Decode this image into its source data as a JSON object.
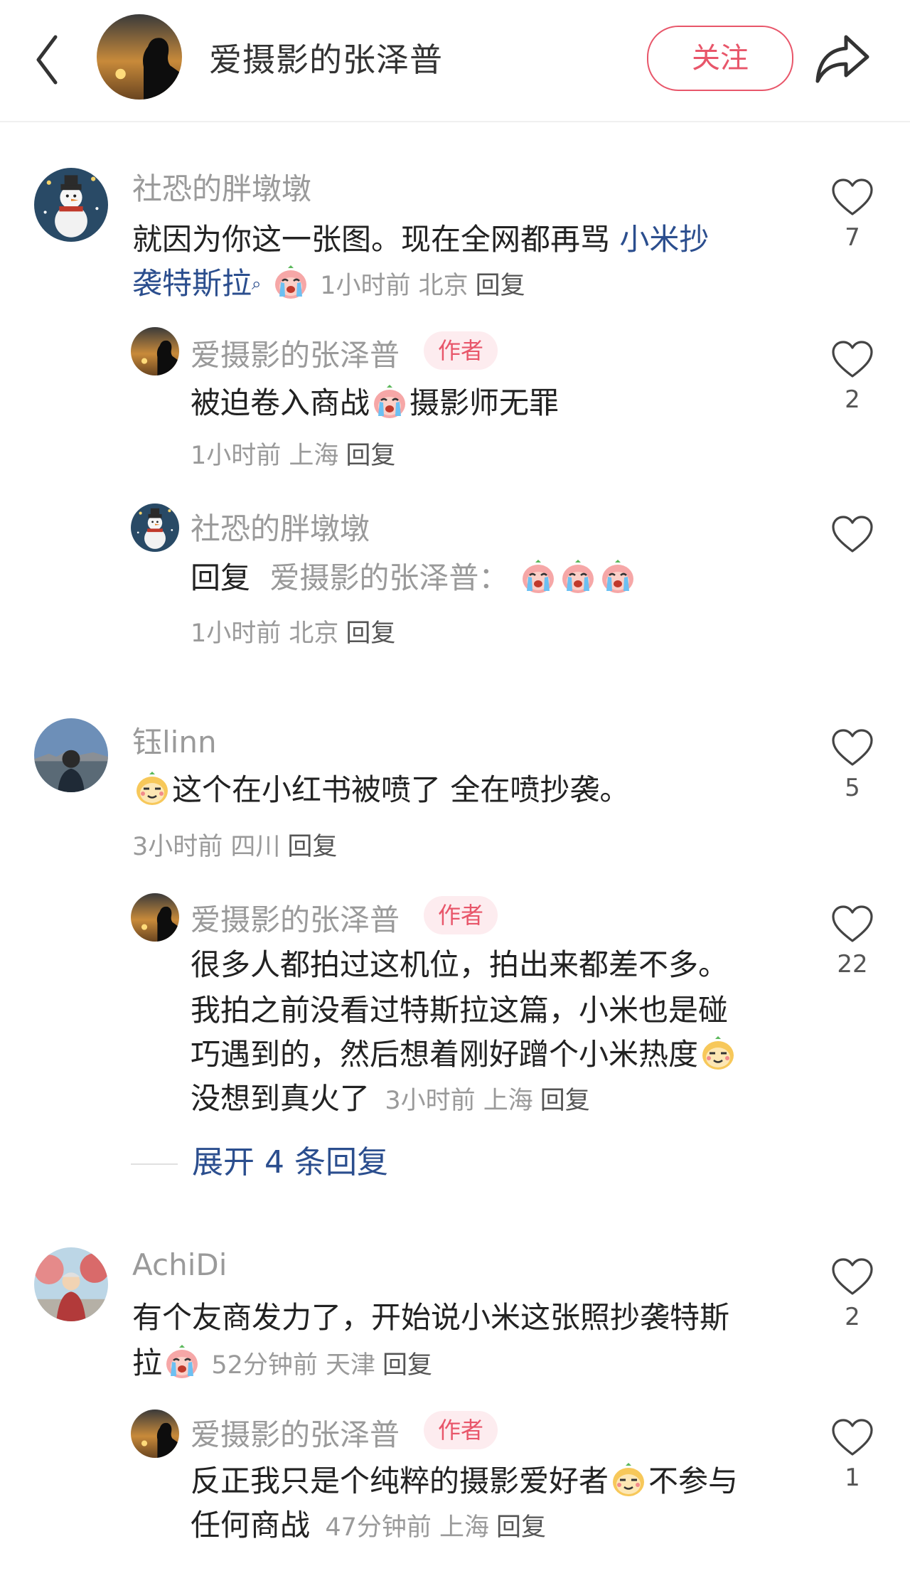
{
  "header": {
    "username": "爱摄影的张泽普",
    "follow_label": "关注"
  },
  "comments": [
    {
      "user": "社恐的胖墩墩",
      "text_before": "就因为你这一张图。现在全网都再骂 ",
      "link": "小米抄",
      "line2_link": "袭特斯拉",
      "meta": "1小时前 北京",
      "reply": "回复",
      "likes": "7"
    },
    {
      "user": "爱摄影的张泽普",
      "badge": "作者",
      "text_a": "被迫卷入商战",
      "text_b": "摄影师无罪",
      "meta": "1小时前 上海",
      "reply": "回复",
      "likes": "2"
    },
    {
      "user": "社恐的胖墩墩",
      "reply_prefix": "回复",
      "reply_target": "爱摄影的张泽普：",
      "meta": "1小时前 北京",
      "reply": "回复"
    },
    {
      "user": "钰linn",
      "text": "这个在小红书被喷了 全在喷抄袭。",
      "meta": "3小时前 四川",
      "reply": "回复",
      "likes": "5"
    },
    {
      "user": "爱摄影的张泽普",
      "badge": "作者",
      "line1": "很多人都拍过这机位，拍出来都差不多。",
      "line2": "我拍之前没看过特斯拉这篇，小米也是碰",
      "line3": "巧遇到的，然后想着刚好蹭个小米热度",
      "line4": "没想到真火了",
      "meta": "3小时前 上海",
      "reply": "回复",
      "likes": "22"
    },
    {
      "user": "AchiDi",
      "line1": "有个友商发力了，开始说小米这张照抄袭特斯",
      "line2": "拉",
      "meta": "52分钟前 天津",
      "reply": "回复",
      "likes": "2"
    },
    {
      "user": "爱摄影的张泽普",
      "badge": "作者",
      "line1a": "反正我只是个纯粹的摄影爱好者",
      "line1b": "不参与",
      "line2": "任何商战",
      "meta": "47分钟前 上海",
      "reply": "回复",
      "likes": "1"
    }
  ],
  "expand_label": "展开 4 条回复",
  "colors": {
    "accent": "#e8566a",
    "link": "#2b4e8e",
    "meta": "#9a9a9a"
  },
  "icons": [
    "back-chevron-icon",
    "share-arrow-icon",
    "heart-outline-icon",
    "crying-face-emoji",
    "smug-face-emoji",
    "search-icon"
  ]
}
